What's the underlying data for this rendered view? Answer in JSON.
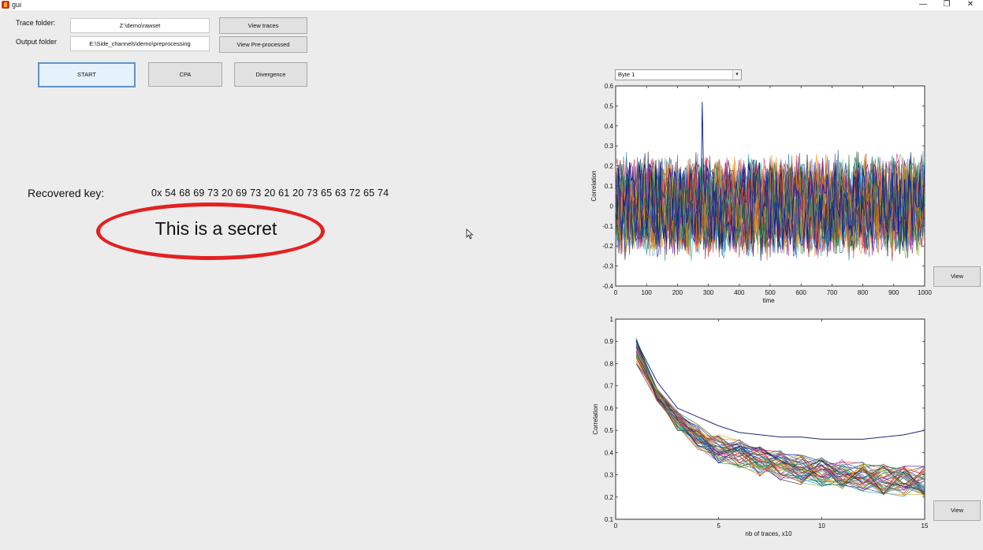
{
  "window": {
    "title": "gui",
    "minimize": "—",
    "restore": "❐",
    "close": "✕"
  },
  "form": {
    "trace_folder_label": "Trace folder:",
    "trace_folder_value": "Z:\\demo\\rawset",
    "view_traces_label": "View traces",
    "output_folder_label": "Output folder",
    "output_folder_value": "E:\\Side_channels\\demo\\preprocessing",
    "view_preprocessed_label": "View Pre-processed"
  },
  "actions": {
    "start_label": "START",
    "cpa_label": "CPA",
    "divergence_label": "Divergence"
  },
  "result": {
    "recovered_key_label": "Recovered key:",
    "recovered_key_value": "0x 54 68 69 73 20 69 73 20 61 20 73 65 63 72 65 74",
    "secret_text": "This is a secret",
    "highlight_color": "#e32121"
  },
  "byte_select": {
    "selected": "Byte 1"
  },
  "view_buttons": {
    "top_label": "View",
    "bottom_label": "View"
  },
  "chart_data": [
    {
      "type": "line",
      "title": "",
      "xlabel": "time",
      "ylabel": "Correlation",
      "xlim": [
        0,
        1000
      ],
      "ylim": [
        -0.4,
        0.6
      ],
      "xticks": [
        "0",
        "100",
        "200",
        "300",
        "400",
        "500",
        "600",
        "700",
        "800",
        "900",
        "1000"
      ],
      "yticks": [
        "-0.4",
        "-0.3",
        "-0.2",
        "-0.1",
        "0",
        "0.1",
        "0.2",
        "0.3",
        "0.4",
        "0.5",
        "0.6"
      ],
      "series_count": 256,
      "noise_band": [
        -0.3,
        0.3
      ],
      "peak": {
        "x": 280,
        "y": 0.52
      },
      "grid": false
    },
    {
      "type": "line",
      "title": "",
      "xlabel": "nb of traces, x10",
      "ylabel": "Correlation",
      "xlim": [
        0,
        15
      ],
      "ylim": [
        0.1,
        1
      ],
      "xticks": [
        "0",
        "5",
        "10",
        "15"
      ],
      "yticks": [
        "0.1",
        "0.2",
        "0.3",
        "0.4",
        "0.5",
        "0.6",
        "0.7",
        "0.8",
        "0.9",
        "1"
      ],
      "series_count": 256,
      "x": [
        1,
        2,
        3,
        4,
        5,
        6,
        7,
        8,
        9,
        10,
        11,
        12,
        13,
        14,
        15
      ],
      "typical_decay": [
        0.85,
        0.66,
        0.54,
        0.47,
        0.42,
        0.39,
        0.36,
        0.34,
        0.32,
        0.31,
        0.3,
        0.29,
        0.28,
        0.27,
        0.27
      ],
      "correct_key_series": [
        0.9,
        0.72,
        0.6,
        0.56,
        0.52,
        0.49,
        0.48,
        0.47,
        0.47,
        0.46,
        0.46,
        0.46,
        0.47,
        0.48,
        0.5
      ],
      "grid": false
    }
  ]
}
